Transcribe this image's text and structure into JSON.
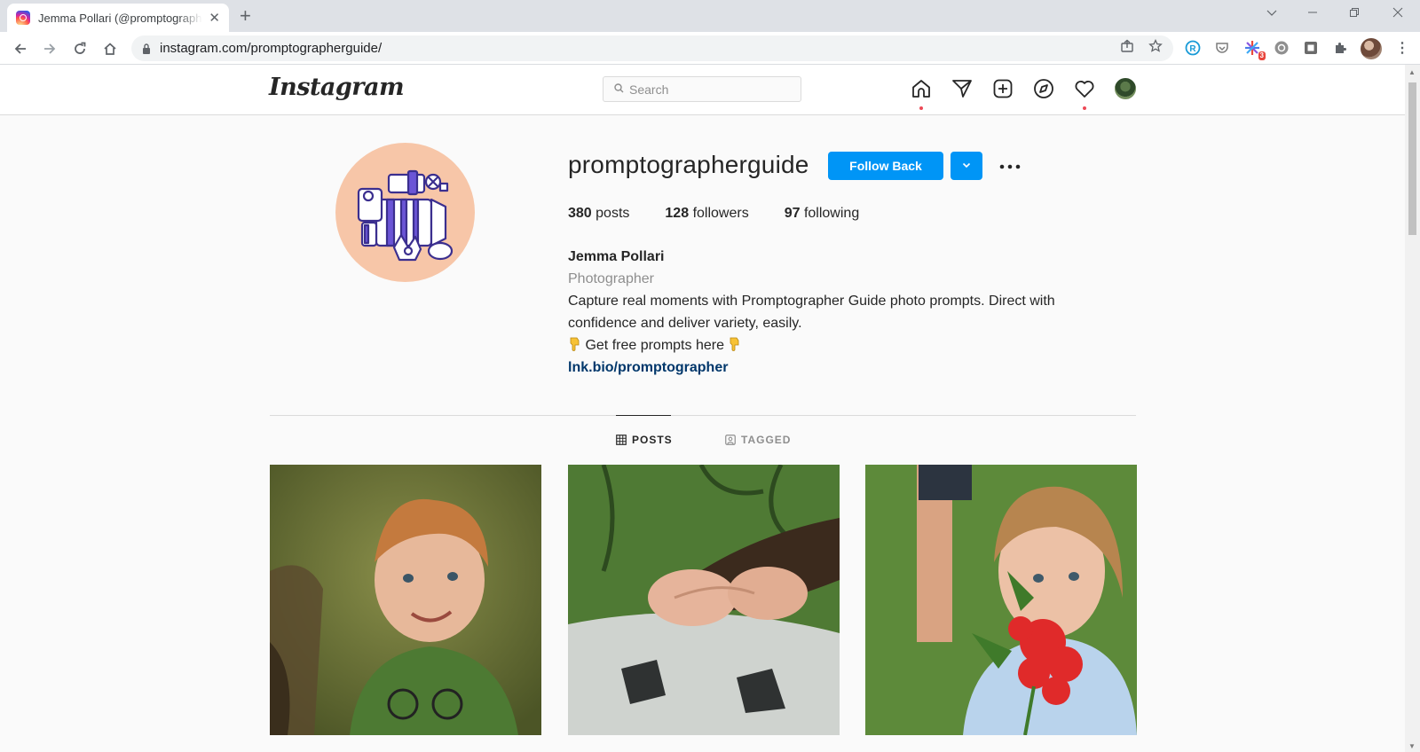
{
  "browser": {
    "tab_title": "Jemma Pollari (@promptographerguide)",
    "url": "instagram.com/promptographerguide/",
    "extension_badge": "3",
    "icons": [
      "back-icon",
      "forward-icon",
      "reload-icon",
      "home-icon",
      "lock-icon",
      "share-icon",
      "star-icon",
      "extensions-icon",
      "menu-icon"
    ]
  },
  "instagram": {
    "logo": "Instagram",
    "search_placeholder": "Search",
    "nav_icons": [
      "home-icon",
      "direct-icon",
      "new-post-icon",
      "explore-icon",
      "activity-icon"
    ],
    "notification_color": "#ed4956"
  },
  "profile": {
    "username": "promptographerguide",
    "follow_label": "Follow Back",
    "stats": {
      "posts": {
        "count": "380",
        "label": "posts"
      },
      "followers": {
        "count": "128",
        "label": "followers"
      },
      "following": {
        "count": "97",
        "label": "following"
      }
    },
    "full_name": "Jemma Pollari",
    "category": "Photographer",
    "bio_line1": "Capture real moments with Promptographer Guide photo prompts. Direct with",
    "bio_line2": "confidence and deliver variety, easily.",
    "bio_line3": "Get free prompts here",
    "link": "lnk.bio/promptographer"
  },
  "tabs": {
    "posts": "POSTS",
    "tagged": "TAGGED"
  },
  "colors": {
    "accent": "#0095f6",
    "avatar_bg": "#f7c6a8",
    "link": "#00376b"
  }
}
